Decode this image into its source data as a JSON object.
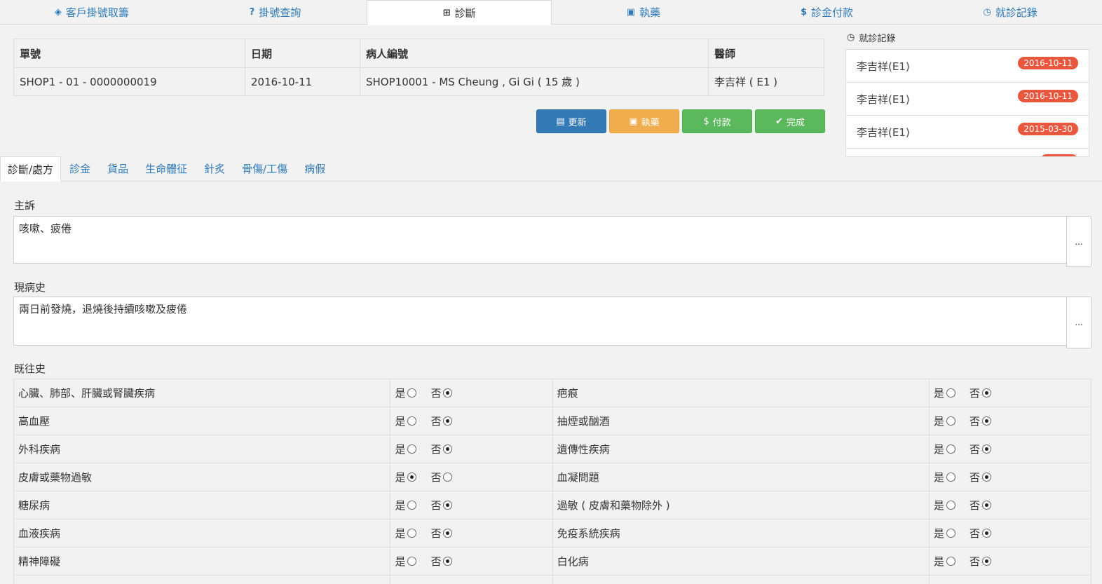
{
  "topnav": [
    {
      "label": "客戶掛號取籌",
      "icon": "tag-icon",
      "glyph": "◈"
    },
    {
      "label": "掛號查詢",
      "icon": "question-icon",
      "glyph": "?"
    },
    {
      "label": "診斷",
      "icon": "plus-square-icon",
      "glyph": "⊞"
    },
    {
      "label": "執藥",
      "icon": "briefcase-icon",
      "glyph": "▣"
    },
    {
      "label": "診金付款",
      "icon": "dollar-icon",
      "glyph": "$"
    },
    {
      "label": "就診記錄",
      "icon": "clock-icon",
      "glyph": "◷"
    }
  ],
  "info": {
    "headers": {
      "order_no": "單號",
      "date": "日期",
      "patient_no": "病人編號",
      "doctor": "醫師"
    },
    "values": {
      "order_no": "SHOP1 - 01 - 0000000019",
      "date": "2016-10-11",
      "patient_no": "SHOP10001 - MS Cheung , Gi Gi ( 15 歲 )",
      "doctor": "李吉祥 ( E1 )"
    }
  },
  "actions": {
    "update": "更新",
    "dispense": "執藥",
    "pay": "付款",
    "complete": "完成"
  },
  "visit_records": {
    "title": "就診記錄",
    "items": [
      {
        "name": "李吉祥(E1)",
        "date": "2016-10-11"
      },
      {
        "name": "李吉祥(E1)",
        "date": "2016-10-11"
      },
      {
        "name": "李吉祥(E1)",
        "date": "2015-03-30"
      }
    ]
  },
  "subtabs": [
    "診斷/處方",
    "診金",
    "貨品",
    "生命體征",
    "針炙",
    "骨傷/工傷",
    "病假"
  ],
  "chief_complaint": {
    "label": "主訴",
    "value": "咳嗽、疲倦",
    "more": "..."
  },
  "present_illness": {
    "label": "現病史",
    "value": "兩日前發燒，退燒後持續咳嗽及疲倦",
    "more": "..."
  },
  "past_history": {
    "label": "既往史",
    "yes": "是",
    "no": "否",
    "rows": [
      {
        "left": "心臟、肺部、肝臟或腎臟疾病",
        "left_yes": false,
        "right": "疤痕",
        "right_yes": false
      },
      {
        "left": "高血壓",
        "left_yes": false,
        "right": "抽煙或酗酒",
        "right_yes": false
      },
      {
        "left": "外科疾病",
        "left_yes": false,
        "right": "遺傳性疾病",
        "right_yes": false
      },
      {
        "left": "皮膚或藥物過敏",
        "left_yes": true,
        "right": "血凝問題",
        "right_yes": false
      },
      {
        "left": "糖尿病",
        "left_yes": false,
        "right": "過敏 ( 皮膚和藥物除外 )",
        "right_yes": false
      },
      {
        "left": "血液疾病",
        "left_yes": false,
        "right": "免疫系統疾病",
        "right_yes": false
      },
      {
        "left": "精神障礙",
        "left_yes": false,
        "right": "白化病",
        "right_yes": false
      }
    ]
  }
}
